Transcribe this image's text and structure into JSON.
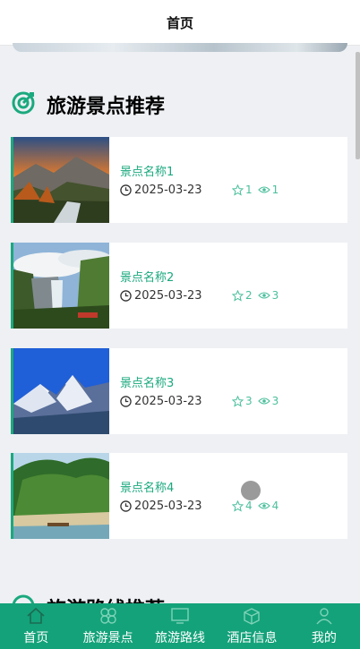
{
  "header": {
    "title": "首页"
  },
  "section": {
    "title": "旅游景点推荐"
  },
  "next_section": {
    "title": "旅游路线推荐"
  },
  "cards": [
    {
      "name": "景点名称1",
      "date": "2025-03-23",
      "stars": "1",
      "views": "1"
    },
    {
      "name": "景点名称2",
      "date": "2025-03-23",
      "stars": "2",
      "views": "3"
    },
    {
      "name": "景点名称3",
      "date": "2025-03-23",
      "stars": "3",
      "views": "3"
    },
    {
      "name": "景点名称4",
      "date": "2025-03-23",
      "stars": "4",
      "views": "4"
    }
  ],
  "tabbar": {
    "items": [
      {
        "label": "首页",
        "icon": "home-icon"
      },
      {
        "label": "旅游景点",
        "icon": "grid-icon"
      },
      {
        "label": "旅游路线",
        "icon": "monitor-icon"
      },
      {
        "label": "酒店信息",
        "icon": "box-icon"
      },
      {
        "label": "我的",
        "icon": "user-icon"
      }
    ]
  },
  "colors": {
    "accent": "#1aa97e",
    "tabbar": "#14a27a"
  }
}
